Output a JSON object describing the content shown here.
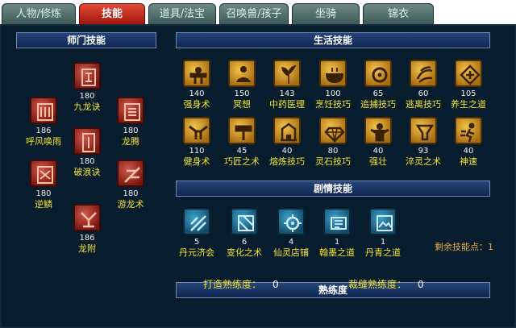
{
  "tabs": [
    {
      "label": "人物/修炼",
      "active": false
    },
    {
      "label": "技能",
      "active": true
    },
    {
      "label": "道具/法宝",
      "active": false
    },
    {
      "label": "召唤兽/孩子",
      "active": false
    },
    {
      "label": "坐骑",
      "active": false
    },
    {
      "label": "锦衣",
      "active": false
    }
  ],
  "sections": {
    "school": "师门技能",
    "life": "生活技能",
    "story": "剧情技能",
    "proficiency": "熟练度"
  },
  "school_skills": [
    {
      "name": "九龙诀",
      "level": "180",
      "icon": "dragon-seal-icon"
    },
    {
      "name": "呼风唤雨",
      "level": "186",
      "icon": "rain-seal-icon"
    },
    {
      "name": "龙腾",
      "level": "180",
      "icon": "dragon-rise-seal-icon"
    },
    {
      "name": "破浪诀",
      "level": "180",
      "icon": "wave-seal-icon"
    },
    {
      "name": "逆鳞",
      "level": "180",
      "icon": "scale-seal-icon"
    },
    {
      "name": "游龙术",
      "level": "180",
      "icon": "swim-dragon-seal-icon"
    },
    {
      "name": "龙附",
      "level": "186",
      "icon": "dragon-attach-seal-icon"
    }
  ],
  "life_skills": [
    {
      "name": "强身术",
      "level": "140",
      "icon": "strength-icon"
    },
    {
      "name": "冥想",
      "level": "150",
      "icon": "meditation-icon"
    },
    {
      "name": "中药医理",
      "level": "143",
      "icon": "herb-icon"
    },
    {
      "name": "烹饪技巧",
      "level": "100",
      "icon": "cooking-icon"
    },
    {
      "name": "追捕技巧",
      "level": "65",
      "icon": "hunting-icon"
    },
    {
      "name": "逃离技巧",
      "level": "60",
      "icon": "escape-icon"
    },
    {
      "name": "养生之道",
      "level": "105",
      "icon": "health-icon"
    },
    {
      "name": "健身术",
      "level": "110",
      "icon": "fitness-icon"
    },
    {
      "name": "巧匠之术",
      "level": "45",
      "icon": "craftsman-icon"
    },
    {
      "name": "熔炼技巧",
      "level": "40",
      "icon": "smelting-icon"
    },
    {
      "name": "灵石技巧",
      "level": "80",
      "icon": "spirit-stone-icon"
    },
    {
      "name": "强壮",
      "level": "40",
      "icon": "strong-icon"
    },
    {
      "name": "淬灵之术",
      "level": "93",
      "icon": "quench-icon"
    },
    {
      "name": "神速",
      "level": "40",
      "icon": "speed-icon"
    }
  ],
  "story_skills": [
    {
      "name": "丹元济会",
      "level": "5",
      "icon": "elixir-icon"
    },
    {
      "name": "变化之术",
      "level": "6",
      "icon": "transform-icon"
    },
    {
      "name": "仙灵店铺",
      "level": "4",
      "icon": "shop-icon"
    },
    {
      "name": "翰墨之道",
      "level": "1",
      "icon": "ink-icon"
    },
    {
      "name": "丹青之道",
      "level": "1",
      "icon": "painting-icon"
    }
  ],
  "remaining_points": "剩余技能点：1",
  "proficiency": {
    "forging_label": "打造熟练度：",
    "forging_value": "0",
    "tailoring_label": "裁缝熟练度：",
    "tailoring_value": "0"
  },
  "colors": {
    "panel_bg": "#071c2c",
    "header_bg": "#1a3669",
    "skill_name": "#f2e332",
    "active_tab": "#c42a1a",
    "remaining_text": "#e7ab44"
  }
}
